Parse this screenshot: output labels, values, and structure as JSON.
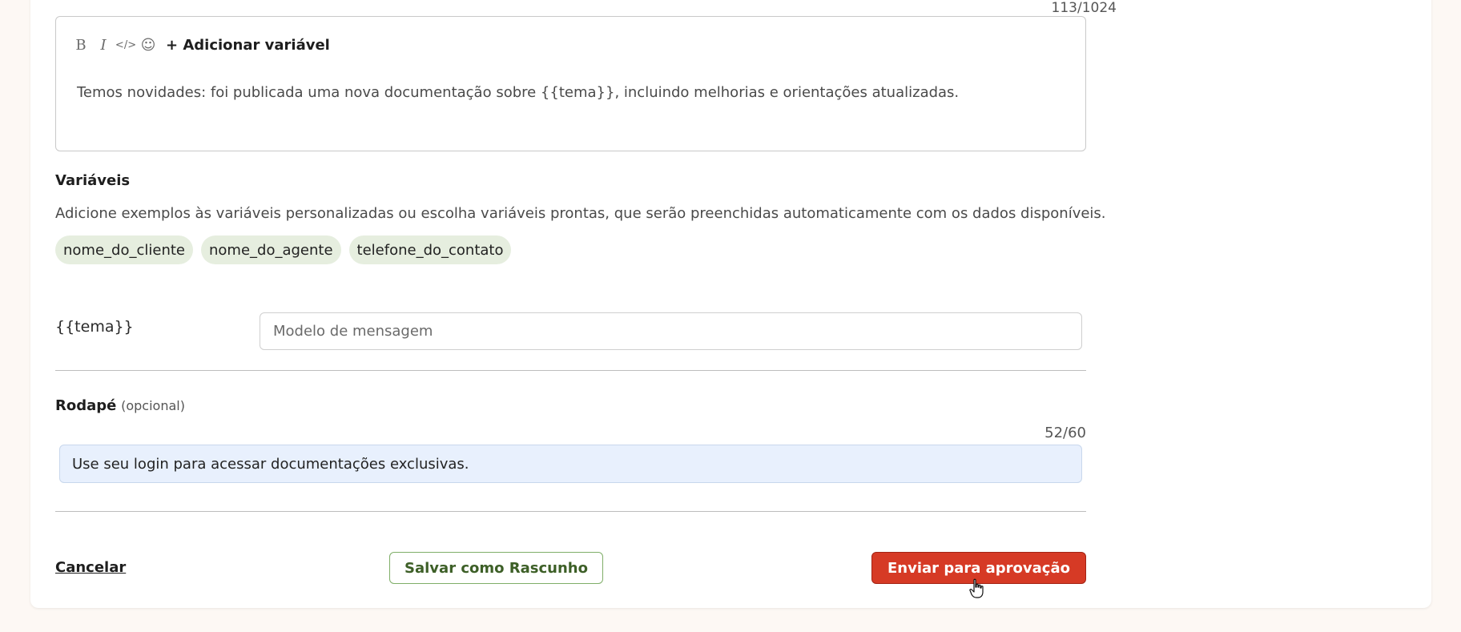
{
  "editor": {
    "char_counter": "113/1024",
    "toolbar": {
      "bold": "B",
      "italic": "I",
      "code": "</>",
      "emoji": "☺",
      "add_variable": "+ Adicionar variável"
    },
    "body_text": "Temos novidades: foi publicada uma nova documentação sobre {{tema}}, incluindo melhorias e orientações atualizadas."
  },
  "variables": {
    "title": "Variáveis",
    "description": "Adicione exemplos às variáveis personalizadas ou escolha variáveis prontas, que serão preenchidas automaticamente com os dados disponíveis.",
    "chips": [
      "nome_do_cliente",
      "nome_do_agente",
      "telefone_do_contato"
    ],
    "field_label": "{{tema}}",
    "field_placeholder": "Modelo de mensagem",
    "field_value": ""
  },
  "footer": {
    "title": "Rodapé",
    "optional": "(opcional)",
    "char_counter": "52/60",
    "value": "Use seu login para acessar documentações exclusivas."
  },
  "actions": {
    "cancel": "Cancelar",
    "save_draft": "Salvar como Rascunho",
    "submit": "Enviar para aprovação"
  },
  "colors": {
    "submit_bg": "#d63a25",
    "draft_border": "#7fae68",
    "chip_bg": "#e6eedf",
    "footer_input_bg": "#e8f0fd"
  }
}
